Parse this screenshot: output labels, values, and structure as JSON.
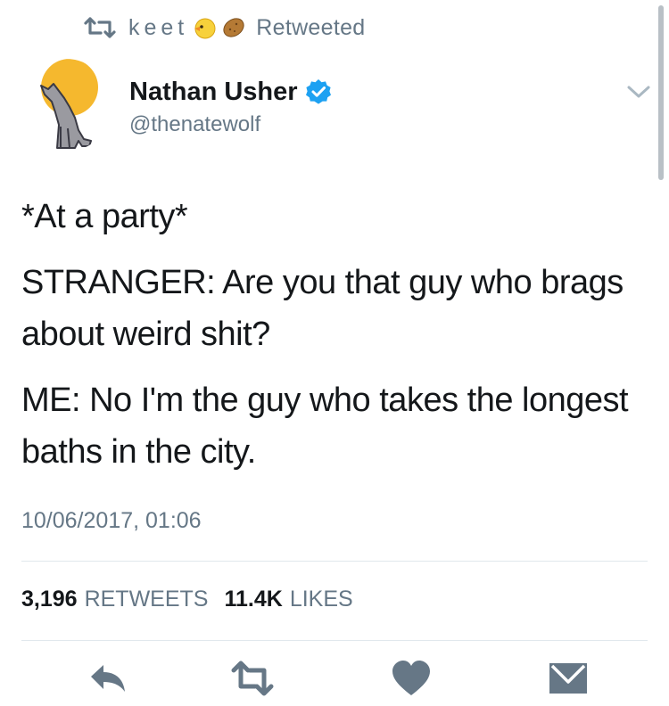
{
  "retweet_context": {
    "retweeter": "keet",
    "emojis": [
      "chick-emoji",
      "potato-emoji"
    ],
    "label": "Retweeted"
  },
  "author": {
    "name": "Nathan Usher",
    "handle": "@thenatewolf",
    "verified": true,
    "avatar": "howling-wolf-moon-avatar"
  },
  "tweet": {
    "paragraphs": [
      "*At a party*",
      "STRANGER: Are you that guy who brags about weird shit?",
      "ME: No I'm the guy who takes the longest baths in the city."
    ],
    "timestamp": "10/06/2017, 01:06"
  },
  "stats": {
    "retweets_count": "3,196",
    "retweets_label": "RETWEETS",
    "likes_count": "11.4K",
    "likes_label": "LIKES"
  },
  "actions": [
    "reply-icon",
    "retweet-icon",
    "like-icon",
    "direct-message-icon"
  ],
  "colors": {
    "text": "#14171a",
    "secondary": "#657786",
    "verified_blue": "#1da1f2",
    "icon_gray": "#667786",
    "divider": "#e1e8ed"
  }
}
